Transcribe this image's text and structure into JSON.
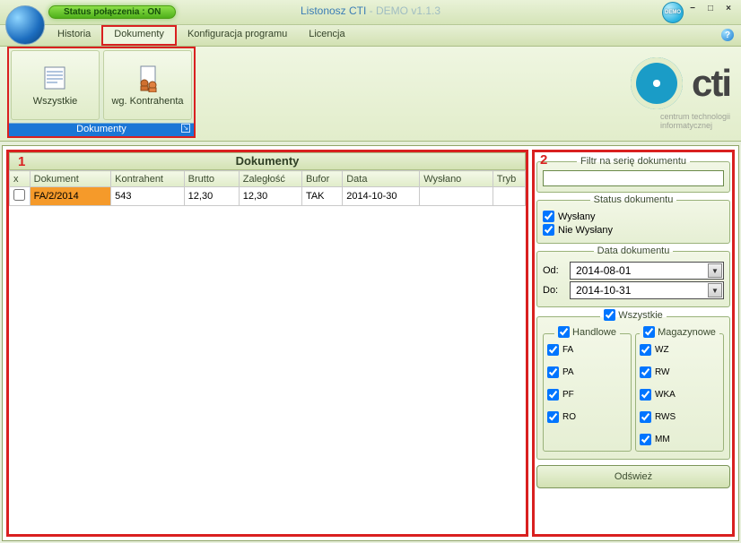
{
  "window": {
    "status_label": "Status połączenia : ON",
    "app_name": "Listonosz CTI",
    "app_suffix": " - DEMO v1.1.3",
    "demo_badge": "DEMO",
    "min": "−",
    "max": "□",
    "close": "×"
  },
  "menu": {
    "items": [
      "Historia",
      "Dokumenty",
      "Konfiguracja programu",
      "Licencja"
    ],
    "active_index": 1,
    "help": "?"
  },
  "ribbon": {
    "group_title": "Dokumenty",
    "btn_all": "Wszystkie",
    "btn_by_contractor": "wg. Kontrahenta"
  },
  "brand": {
    "text": "cti",
    "sub1": "centrum technologii",
    "sub2": "informatycznej"
  },
  "panel_left": {
    "number": "1",
    "title": "Dokumenty",
    "columns": [
      "x",
      "Dokument",
      "Kontrahent",
      "Brutto",
      "Zaległość",
      "Bufor",
      "Data",
      "Wysłano",
      "Tryb"
    ],
    "rows": [
      {
        "x": false,
        "dokument": "FA/2/2014",
        "kontrahent": "543",
        "brutto": "12,30",
        "zaleglosc": "12,30",
        "bufor": "TAK",
        "data": "2014-10-30",
        "wyslano": "",
        "tryb": ""
      }
    ]
  },
  "panel_right": {
    "number": "2",
    "filter_series_label": "Filtr na serię dokumentu",
    "filter_series_value": "",
    "status_label": "Status dokumentu",
    "status_sent": {
      "label": "Wysłany",
      "checked": true
    },
    "status_unsent": {
      "label": "Nie Wysłany",
      "checked": true
    },
    "date_label": "Data dokumentu",
    "date_from_label": "Od:",
    "date_from": "2014-08-01",
    "date_to_label": "Do:",
    "date_to": "2014-10-31",
    "all_label": "Wszystkie",
    "all_checked": true,
    "handlowe": {
      "label": "Handlowe",
      "checked": true,
      "items": [
        {
          "code": "FA",
          "checked": true
        },
        {
          "code": "PA",
          "checked": true
        },
        {
          "code": "PF",
          "checked": true
        },
        {
          "code": "RO",
          "checked": true
        }
      ]
    },
    "magazynowe": {
      "label": "Magazynowe",
      "checked": true,
      "items": [
        {
          "code": "WZ",
          "checked": true
        },
        {
          "code": "RW",
          "checked": true
        },
        {
          "code": "WKA",
          "checked": true
        },
        {
          "code": "RWS",
          "checked": true
        },
        {
          "code": "MM",
          "checked": true
        }
      ]
    },
    "refresh": "Odśwież"
  }
}
